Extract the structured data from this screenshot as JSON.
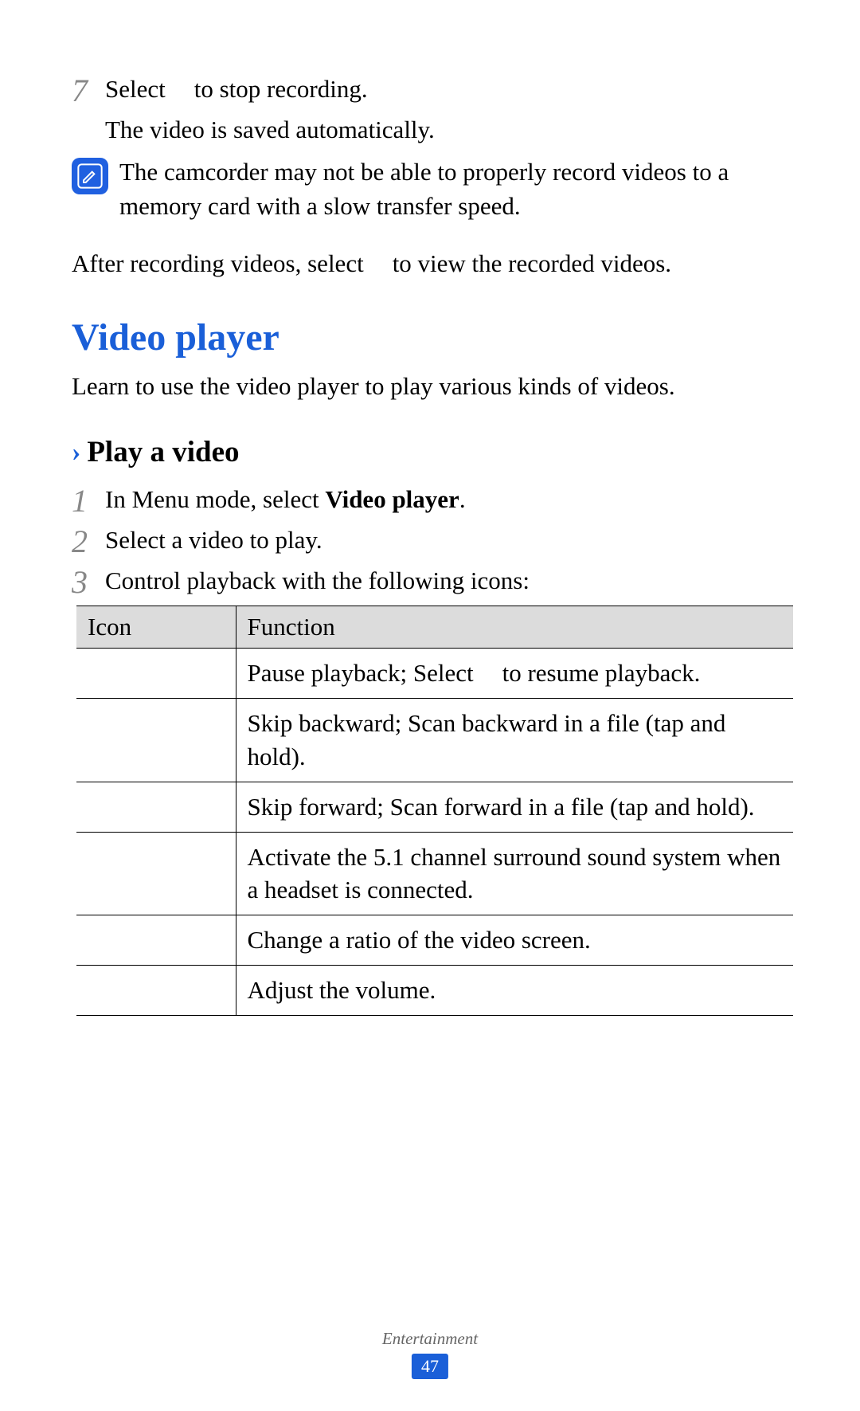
{
  "step7": {
    "number": "7",
    "line1a": "Select",
    "line1b": "to stop recording.",
    "line2": "The video is saved automatically."
  },
  "note": {
    "text": "The camcorder may not be able to properly record videos to a memory card with a slow transfer speed."
  },
  "after": {
    "part1": "After recording videos, select",
    "part2": "to view the recorded videos."
  },
  "section": {
    "heading": "Video player",
    "intro": "Learn to use the video player to play various kinds of videos."
  },
  "sub": {
    "heading": "Play a video"
  },
  "steps": {
    "s1": {
      "number": "1",
      "text_pre": "In Menu mode, select ",
      "text_bold": "Video player",
      "text_post": "."
    },
    "s2": {
      "number": "2",
      "text": "Select a video to play."
    },
    "s3": {
      "number": "3",
      "text": "Control playback with the following icons:"
    }
  },
  "table": {
    "header_icon": "Icon",
    "header_function": "Function",
    "rows": [
      {
        "function_pre": "Pause playback; Select",
        "function_post": "to resume playback."
      },
      {
        "function": "Skip backward; Scan backward in a file (tap and hold)."
      },
      {
        "function": "Skip forward; Scan forward in a file (tap and hold)."
      },
      {
        "function": "Activate the 5.1 channel surround sound system when a headset is connected."
      },
      {
        "function": "Change a ratio of the video screen."
      },
      {
        "function": "Adjust the volume."
      }
    ]
  },
  "footer": {
    "category": "Entertainment",
    "page": "47"
  }
}
